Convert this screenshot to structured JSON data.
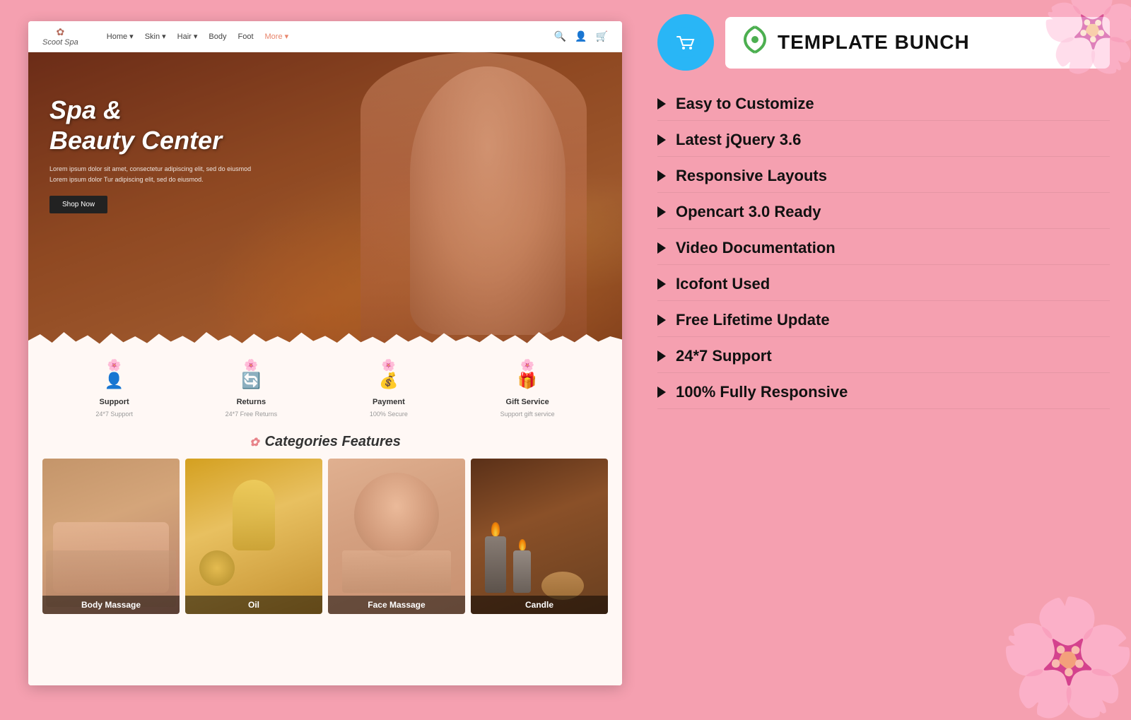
{
  "page": {
    "bg_color": "#f5a0b0"
  },
  "left_panel": {
    "navbar": {
      "logo_text": "Scoot Spa",
      "nav_links": [
        {
          "label": "Home",
          "has_arrow": true
        },
        {
          "label": "Skin",
          "has_arrow": true
        },
        {
          "label": "Hair",
          "has_arrow": true
        },
        {
          "label": "Body"
        },
        {
          "label": "Foot"
        },
        {
          "label": "More",
          "has_arrow": true,
          "active": true
        }
      ]
    },
    "hero": {
      "title_line1": "Spa &",
      "title_line2": "Beauty Center",
      "desc_line1": "Lorem ipsum dolor sit amet, consectetur adipiscing elit, sed do eiusmod",
      "desc_line2": "Lorem ipsum dolor Tur adipiscing elit, sed do eiusmod.",
      "cta_label": "Shop Now"
    },
    "features": [
      {
        "label": "Support",
        "sublabel": "24*7 Support"
      },
      {
        "label": "Returns",
        "sublabel": "24*7 Free Returns"
      },
      {
        "label": "Payment",
        "sublabel": "100% Secure"
      },
      {
        "label": "Gift Service",
        "sublabel": "Support gift service"
      }
    ],
    "categories": {
      "section_title": "Categories Features",
      "items": [
        {
          "label": "Body Massage",
          "color_class": "cat-body"
        },
        {
          "label": "Oil",
          "color_class": "cat-oil"
        },
        {
          "label": "Face Massage",
          "color_class": "cat-face"
        },
        {
          "label": "Candle",
          "color_class": "cat-candle"
        }
      ]
    }
  },
  "right_panel": {
    "cart_icon": "🛒",
    "brand_logo_icon": "♻",
    "brand_name": "TEMPLATE BUNCH",
    "features": [
      {
        "label": "Easy to Customize"
      },
      {
        "label": "Latest jQuery 3.6"
      },
      {
        "label": "Responsive Layouts"
      },
      {
        "label": "Opencart 3.0 Ready"
      },
      {
        "label": "Video Documentation"
      },
      {
        "label": "Icofont Used"
      },
      {
        "label": "Free Lifetime Update"
      },
      {
        "label": "24*7 Support"
      },
      {
        "label": "100% Fully Responsive"
      }
    ]
  }
}
